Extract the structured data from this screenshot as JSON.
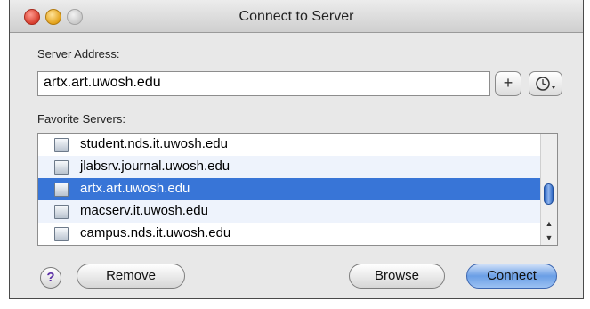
{
  "window": {
    "title": "Connect to Server"
  },
  "server_address": {
    "label": "Server Address:",
    "value": "artx.art.uwosh.edu"
  },
  "buttons": {
    "add": "+",
    "history_icon": "recent-servers-icon",
    "remove": "Remove",
    "browse": "Browse",
    "connect": "Connect",
    "help": "?"
  },
  "favorites": {
    "label": "Favorite Servers:",
    "items": [
      {
        "label": "student.nds.it.uwosh.edu"
      },
      {
        "label": "jlabsrv.journal.uwosh.edu"
      },
      {
        "label": "artx.art.uwosh.edu"
      },
      {
        "label": "macserv.it.uwosh.edu"
      },
      {
        "label": "campus.nds.it.uwosh.edu"
      }
    ],
    "selected_index": 2
  },
  "colors": {
    "selection": "#3875d7",
    "alt_row": "#eef3fc",
    "window_bg": "#e8e8e8"
  }
}
